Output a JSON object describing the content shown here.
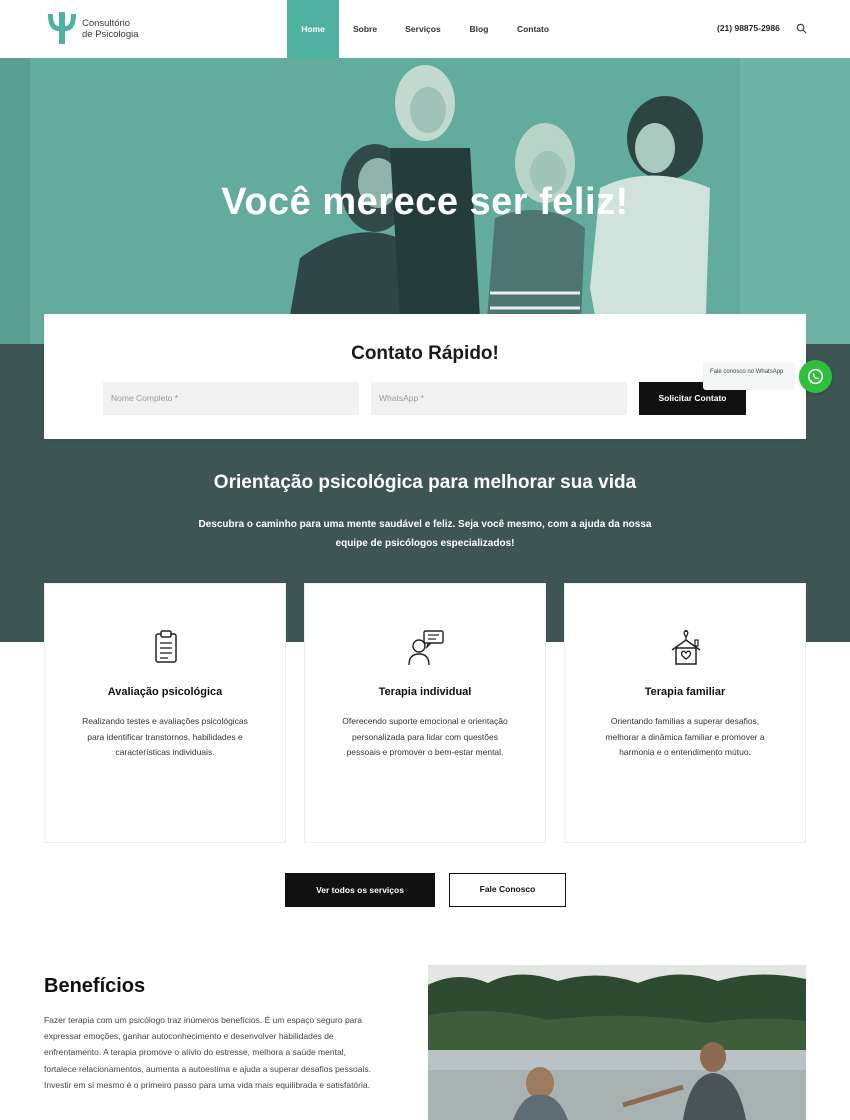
{
  "header": {
    "logo_line1": "Consultório",
    "logo_line2": "de Psicologia",
    "nav": [
      "Home",
      "Sobre",
      "Serviços",
      "Blog",
      "Contato"
    ],
    "phone": "(21) 98875-2986"
  },
  "hero": {
    "title": "Você merece ser feliz!"
  },
  "contact": {
    "title": "Contato Rápido!",
    "name_placeholder": "Nome Completo *",
    "whatsapp_placeholder": "WhatsApp *",
    "submit_label": "Solicitar Contato"
  },
  "whatsapp": {
    "tooltip": "Fale conosco no WhatsApp"
  },
  "orientation": {
    "title": "Orientação psicológica para melhorar sua vida",
    "text": "Descubra o caminho para uma mente saudável e feliz. Seja você mesmo, com a ajuda da nossa equipe de psicólogos especializados!"
  },
  "services": [
    {
      "icon": "clipboard-icon",
      "title": "Avaliação psicológica",
      "desc": "Realizando testes e avaliações psicológicas para identificar transtornos, habilidades e características individuais."
    },
    {
      "icon": "person-chat-icon",
      "title": "Terapia individual",
      "desc": "Oferecendo suporte emocional e orientação personalizada para lidar com questões pessoais e promover o bem-estar mental."
    },
    {
      "icon": "family-home-icon",
      "title": "Terapia familiar",
      "desc": "Orientando famílias a superar desafios, melhorar a dinâmica familiar e promover a harmonia e o entendimento mútuo."
    }
  ],
  "buttons": {
    "all_services": "Ver todos os serviços",
    "contact_us": "Fale Conosco"
  },
  "benefits": {
    "title": "Benefícios",
    "text": "Fazer terapia com um psicólogo traz inúmeros benefícios. É um espaço seguro para expressar emoções, ganhar autoconhecimento e desenvolver habilidades de enfrentamento. A terapia promove o alívio do estresse, melhora a saúde mental, fortalece relacionamentos, aumenta a autoestima e ajuda a superar desafios pessoais. Investir em si mesmo é o primeiro passo para uma vida mais equilibrada e satisfatória."
  },
  "colors": {
    "accent": "#4fb1a0",
    "dark_band": "#3d5553",
    "whatsapp": "#30bf3c"
  }
}
